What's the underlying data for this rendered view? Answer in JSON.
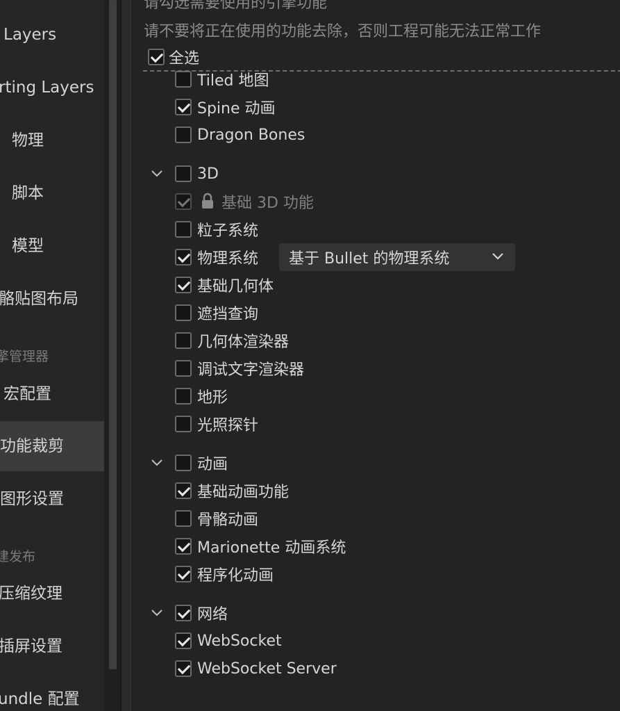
{
  "sidebar": {
    "items": [
      {
        "label": " Layers"
      },
      {
        "label": "rting Layers"
      },
      {
        "label": "物理"
      },
      {
        "label": "脚本"
      },
      {
        "label": "模型"
      },
      {
        "label": "骼贴图布局"
      },
      {
        "group": "擎管理器"
      },
      {
        "label": "宏配置"
      },
      {
        "label": "功能裁剪",
        "active": true
      },
      {
        "label": "图形设置"
      },
      {
        "group": "建发布"
      },
      {
        "label": "压缩纹理"
      },
      {
        "label": "插屏设置"
      },
      {
        "label": "undle 配置"
      }
    ]
  },
  "main": {
    "hint_top": "请勾选需要使用的引擎功能",
    "hint_warning": "请不要将正在使用的功能去除，否则工程可能无法正常工作",
    "select_all": {
      "label": "全选",
      "checked": true
    },
    "items": [
      {
        "label": "Tiled 地图",
        "checked": false
      },
      {
        "label": "Spine 动画",
        "checked": true
      },
      {
        "label": "Dragon Bones",
        "checked": false
      },
      {
        "label": "3D",
        "checked": false,
        "group": true
      },
      {
        "label": "基础 3D 功能",
        "checked": true,
        "locked": true
      },
      {
        "label": "粒子系统",
        "checked": false
      },
      {
        "label": "物理系统",
        "checked": true,
        "select": "基于 Bullet 的物理系统"
      },
      {
        "label": "基础几何体",
        "checked": true
      },
      {
        "label": "遮挡查询",
        "checked": false
      },
      {
        "label": "几何体渲染器",
        "checked": false
      },
      {
        "label": "调试文字渲染器",
        "checked": false
      },
      {
        "label": "地形",
        "checked": false
      },
      {
        "label": "光照探针",
        "checked": false
      },
      {
        "label": "动画",
        "checked": false,
        "group": true
      },
      {
        "label": "基础动画功能",
        "checked": true
      },
      {
        "label": "骨骼动画",
        "checked": false
      },
      {
        "label": "Marionette 动画系统",
        "checked": true
      },
      {
        "label": "程序化动画",
        "checked": true
      },
      {
        "label": "网络",
        "checked": true,
        "group": true
      },
      {
        "label": "WebSocket",
        "checked": true
      },
      {
        "label": "WebSocket Server",
        "checked": true
      }
    ]
  },
  "icons": {
    "expand": "chevron-down-icon",
    "lock": "lock-icon",
    "dropdown": "chevron-down-icon"
  },
  "colors": {
    "background": "#232323",
    "sidebar": "#262626",
    "active_item": "#3c3c3c",
    "select_bg": "#333333"
  }
}
